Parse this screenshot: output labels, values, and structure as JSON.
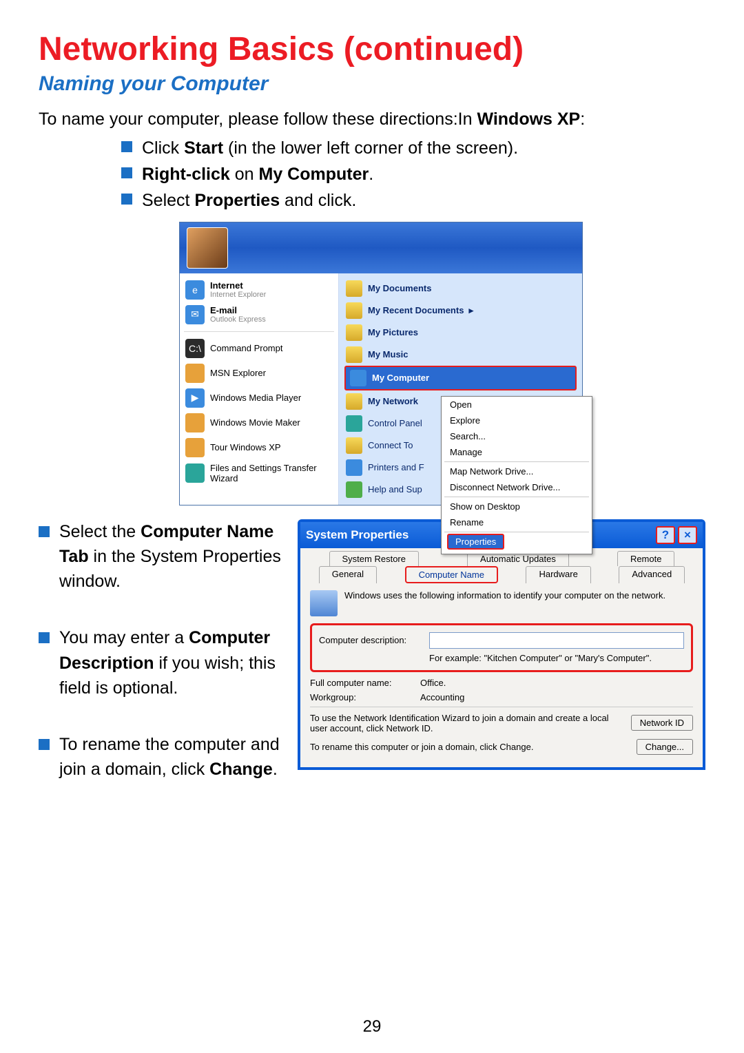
{
  "title": "Networking Basics (continued)",
  "subtitle": "Naming your Computer",
  "intro_pre": "To name your computer, please follow these directions:In ",
  "intro_bold": "Windows XP",
  "intro_post": ":",
  "bullets_top": [
    {
      "pre": "Click ",
      "b1": "Start",
      "post": " (in the lower left corner of the screen)."
    },
    {
      "pre": "",
      "b1": "Right-click",
      "mid": " on ",
      "b2": "My Computer",
      "post": "."
    },
    {
      "pre": "Select ",
      "b1": "Properties",
      "post": " and click."
    }
  ],
  "start_menu": {
    "left": [
      {
        "title": "Internet",
        "sub": "Internet Explorer",
        "color": "ic-blue"
      },
      {
        "title": "E-mail",
        "sub": "Outlook Express",
        "color": "ic-blue"
      },
      {
        "title": "Command Prompt",
        "sub": "",
        "color": "ic-dark"
      },
      {
        "title": "MSN Explorer",
        "sub": "",
        "color": "ic-orange"
      },
      {
        "title": "Windows Media Player",
        "sub": "",
        "color": "ic-blue"
      },
      {
        "title": "Windows Movie Maker",
        "sub": "",
        "color": "ic-orange"
      },
      {
        "title": "Tour Windows XP",
        "sub": "",
        "color": "ic-orange"
      },
      {
        "title": "Files and Settings Transfer Wizard",
        "sub": "",
        "color": "ic-teal"
      }
    ],
    "right": [
      {
        "label": "My Documents",
        "color": "ic-yel"
      },
      {
        "label": "My Recent Documents",
        "color": "ic-yel",
        "arrow": "▸"
      },
      {
        "label": "My Pictures",
        "color": "ic-yel"
      },
      {
        "label": "My Music",
        "color": "ic-yel"
      },
      {
        "label": "My Computer",
        "color": "ic-blue",
        "selected": true
      },
      {
        "label": "My Network",
        "color": "ic-yel"
      },
      {
        "label": "Control Panel",
        "color": "ic-teal"
      },
      {
        "label": "Connect To",
        "color": "ic-yel"
      },
      {
        "label": "Printers and F",
        "color": "ic-blue"
      },
      {
        "label": "Help and Sup",
        "color": "ic-green"
      }
    ],
    "ctx": [
      "Open",
      "Explore",
      "Search...",
      "Manage",
      "-",
      "Map Network Drive...",
      "Disconnect Network Drive...",
      "-",
      "Show on Desktop",
      "Rename",
      "-",
      "Properties"
    ]
  },
  "bullets_bottom": [
    {
      "parts": [
        "Select the ",
        "Computer Name Tab",
        " in the System Properties window."
      ]
    },
    {
      "parts": [
        "You may enter a ",
        "Computer Description",
        " if you wish; this field is optional."
      ]
    },
    {
      "parts": [
        "To rename the computer and join a domain, click ",
        "Change",
        "."
      ]
    }
  ],
  "dialog": {
    "title": "System Properties",
    "help": "?",
    "close": "×",
    "tabs_row1": [
      "System Restore",
      "Automatic Updates",
      "Remote"
    ],
    "tabs_row2": [
      "General",
      "Computer Name",
      "Hardware",
      "Advanced"
    ],
    "selected_tab": "Computer Name",
    "desc": "Windows uses the following information to identify your computer on the network.",
    "field_label": "Computer description:",
    "hint": "For example: \"Kitchen Computer\" or \"Mary's Computer\".",
    "fullname_label": "Full computer name:",
    "fullname_value": "Office.",
    "workgroup_label": "Workgroup:",
    "workgroup_value": "Accounting",
    "netid_text": "To use the Network Identification Wizard to join a domain and create a local user account, click Network ID.",
    "netid_btn": "Network ID",
    "change_text": "To rename this computer or join a domain, click Change.",
    "change_btn": "Change..."
  },
  "page_number": "29"
}
